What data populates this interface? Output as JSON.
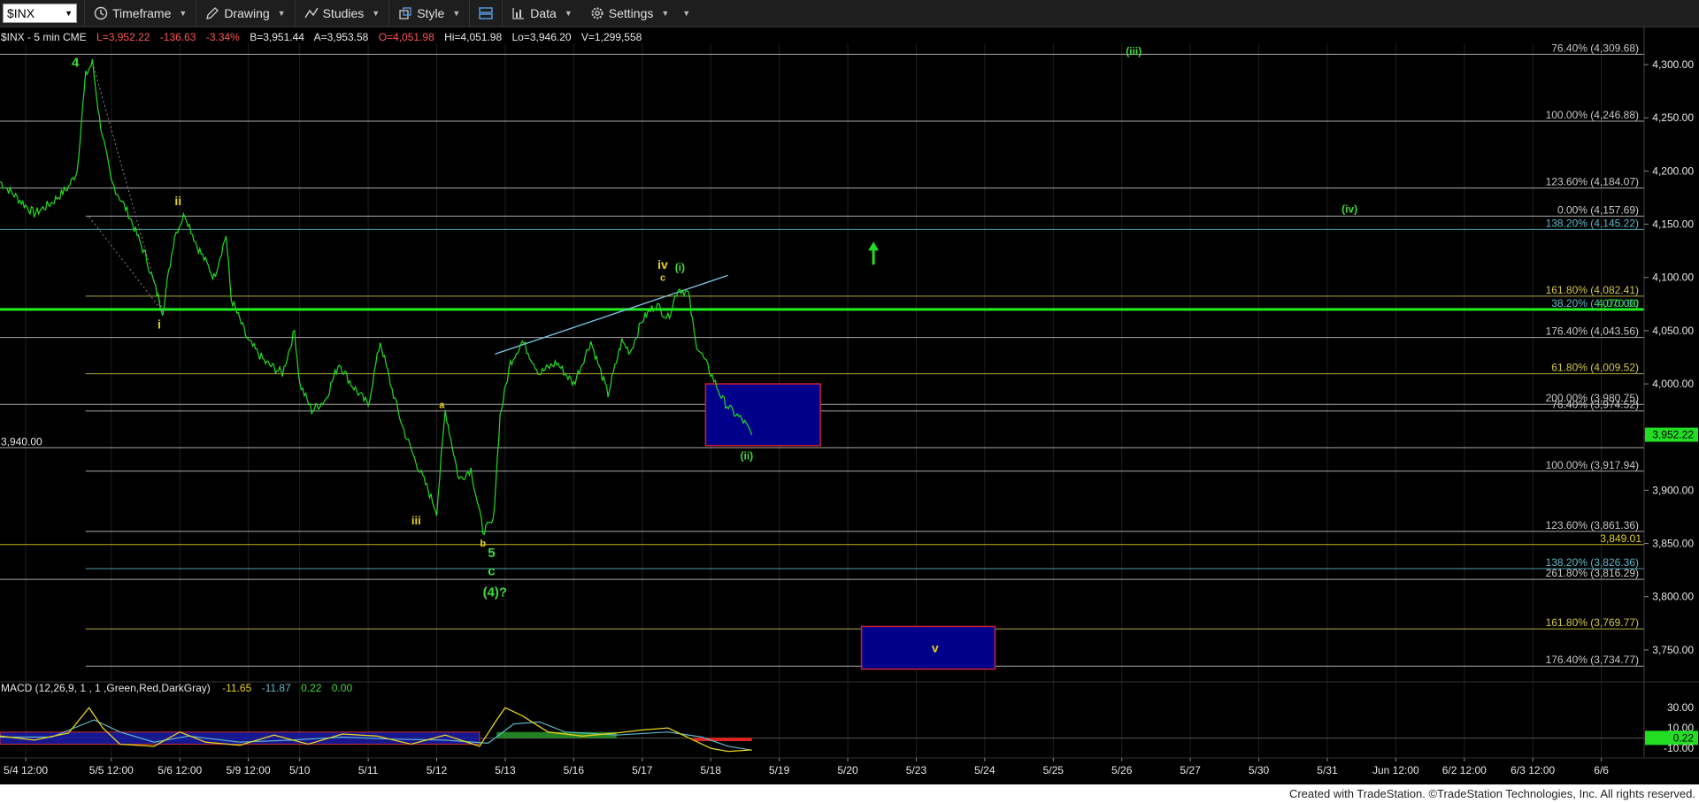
{
  "toolbar": {
    "symbol": "$INX",
    "timeframe": "Timeframe",
    "drawing": "Drawing",
    "studies": "Studies",
    "style": "Style",
    "data": "Data",
    "settings": "Settings"
  },
  "header": {
    "symbol_info": "$INX - 5 min  CME",
    "last": "L=3,952.22",
    "change": "-136.63",
    "change_pct": "-3.34%",
    "bid": "B=3,951.44",
    "ask": "A=3,953.58",
    "open": "O=4,051.98",
    "high": "Hi=4,051.98",
    "low": "Lo=3,946.20",
    "volume": "V=1,299,558"
  },
  "footer": "Created with TradeStation. ©TradeStation Technologies, Inc. All rights reserved.",
  "colors": {
    "price": "#22dd22",
    "fib": "#c8c8c8",
    "wave_yellow": "#e6d21e",
    "wave_green": "#3ddc3d",
    "box_fill": "#00008b",
    "box_border": "#cc2233",
    "trend": "#7ecbe8"
  },
  "chart_data": {
    "type": "line",
    "ylim": [
      3720,
      4320
    ],
    "price_ticks": [
      "4,300.00",
      "4,250.00",
      "4,200.00",
      "4,150.00",
      "4,100.00",
      "4,050.00",
      "4,000.00",
      "3,950.00",
      "3,900.00",
      "3,850.00",
      "3,800.00",
      "3,750.00"
    ],
    "tick_values": [
      4300,
      4250,
      4200,
      4150,
      4100,
      4050,
      4000,
      3950,
      3900,
      3850,
      3800,
      3750
    ],
    "x_labels": [
      "5/4 12:00",
      "5/5 12:00",
      "5/6 12:00",
      "5/9 12:00",
      "5/10",
      "5/11",
      "5/12",
      "5/13",
      "5/16",
      "5/17",
      "5/18",
      "5/19",
      "5/20",
      "5/23",
      "5/24",
      "5/25",
      "5/26",
      "5/27",
      "5/30",
      "5/31",
      "Jun 12:00",
      "6/2 12:00",
      "6/3 12:00",
      "6/6"
    ],
    "x_positions": [
      1.5,
      6.5,
      10.5,
      14.5,
      17.5,
      21.5,
      25.5,
      29.5,
      33.5,
      37.5,
      41.5,
      45.5,
      49.5,
      53.5,
      57.5,
      61.5,
      65.5,
      69.5,
      73.5,
      77.5,
      81.5,
      85.5,
      89.5,
      93.5
    ],
    "x_range": [
      0,
      96
    ],
    "price_series": [
      [
        0,
        4190
      ],
      [
        1,
        4175
      ],
      [
        2,
        4160
      ],
      [
        3,
        4170
      ],
      [
        4,
        4185
      ],
      [
        4.5,
        4200
      ],
      [
        5,
        4290
      ],
      [
        5.4,
        4302
      ],
      [
        5.8,
        4250
      ],
      [
        6.5,
        4190
      ],
      [
        7.5,
        4160
      ],
      [
        8.5,
        4120
      ],
      [
        9.5,
        4068
      ],
      [
        10.2,
        4140
      ],
      [
        10.8,
        4160
      ],
      [
        11.5,
        4130
      ],
      [
        12.5,
        4100
      ],
      [
        13.2,
        4140
      ],
      [
        13.5,
        4080
      ],
      [
        14.5,
        4040
      ],
      [
        15.5,
        4020
      ],
      [
        16.5,
        4010
      ],
      [
        17.2,
        4050
      ],
      [
        17.5,
        4000
      ],
      [
        18.2,
        3975
      ],
      [
        19,
        3985
      ],
      [
        19.8,
        4020
      ],
      [
        20.5,
        4000
      ],
      [
        21.5,
        3980
      ],
      [
        22.2,
        4040
      ],
      [
        22.8,
        4000
      ],
      [
        23.5,
        3960
      ],
      [
        24.2,
        3930
      ],
      [
        25,
        3900
      ],
      [
        25.5,
        3880
      ],
      [
        26,
        3975
      ],
      [
        26.8,
        3910
      ],
      [
        27.5,
        3920
      ],
      [
        28.2,
        3862
      ],
      [
        28.8,
        3870
      ],
      [
        29.2,
        3970
      ],
      [
        29.8,
        4020
      ],
      [
        30.5,
        4040
      ],
      [
        31.5,
        4010
      ],
      [
        32.5,
        4020
      ],
      [
        33.5,
        4000
      ],
      [
        34.5,
        4040
      ],
      [
        35.5,
        3990
      ],
      [
        36.3,
        4040
      ],
      [
        36.8,
        4030
      ],
      [
        37.5,
        4060
      ],
      [
        38.3,
        4075
      ],
      [
        39,
        4062
      ],
      [
        39.6,
        4090
      ],
      [
        40.2,
        4085
      ],
      [
        40.6,
        4040
      ],
      [
        41.5,
        4010
      ],
      [
        42.2,
        3985
      ],
      [
        42.7,
        3975
      ],
      [
        43.4,
        3965
      ],
      [
        43.9,
        3952
      ]
    ],
    "fib_levels": [
      {
        "value": 4309.68,
        "label": "76.40% (4,309.68)",
        "color": "#c8c8c8",
        "x0": 0
      },
      {
        "value": 4246.88,
        "label": "100.00% (4,246.88)",
        "color": "#c8c8c8",
        "x0": 0
      },
      {
        "value": 4184.07,
        "label": "123.60% (4,184.07)",
        "color": "#c8c8c8",
        "x0": 0
      },
      {
        "value": 4157.69,
        "label": "0.00% (4,157.69)",
        "color": "#c8c8c8",
        "x0": 5
      },
      {
        "value": 4145.22,
        "label": "138.20% (4,145.22)",
        "color": "#5fb8c8",
        "x0": 0
      },
      {
        "value": 4082.41,
        "label": "161.80% (4,082.41)",
        "color": "#d2c74a",
        "x0": 5
      },
      {
        "value": 4070.0,
        "label": "38.20% (4,070.00)",
        "color": "#5fb8c8",
        "x0": 0
      },
      {
        "value": 4043.56,
        "label": "176.40% (4,043.56)",
        "color": "#c8c8c8",
        "x0": 0
      },
      {
        "value": 4009.52,
        "label": "61.80% (4,009.52)",
        "color": "#d2c74a",
        "x0": 5
      },
      {
        "value": 3980.75,
        "label": "200.00% (3,980.75)",
        "color": "#c8c8c8",
        "x0": 0
      },
      {
        "value": 3974.52,
        "label": "76.40% (3,974.52)",
        "color": "#c8c8c8",
        "x0": 5
      },
      {
        "value": 3940.0,
        "label": "",
        "color": "#c8c8c8",
        "x0": 0
      },
      {
        "value": 3917.94,
        "label": "100.00% (3,917.94)",
        "color": "#c8c8c8",
        "x0": 5
      },
      {
        "value": 3861.36,
        "label": "123.60% (3,861.36)",
        "color": "#c8c8c8",
        "x0": 5
      },
      {
        "value": 3849.01,
        "label": "",
        "color": "#e6d21e",
        "x0": 0
      },
      {
        "value": 3826.36,
        "label": "138.20% (3,826.36)",
        "color": "#5fb8c8",
        "x0": 5
      },
      {
        "value": 3816.29,
        "label": "261.80% (3,816.29)",
        "color": "#c8c8c8",
        "x0": 0
      },
      {
        "value": 3769.77,
        "label": "161.80% (3,769.77)",
        "color": "#d2c74a",
        "x0": 5
      },
      {
        "value": 3734.77,
        "label": "176.40% (3,734.77)",
        "color": "#c8c8c8",
        "x0": 5
      }
    ],
    "green_line": {
      "value": 4070.0,
      "label": "4,070.00"
    },
    "left_label": {
      "value": 3940.0,
      "label": "3,940.00"
    },
    "last_price": {
      "value": 3952.22,
      "label": "3,952.22"
    },
    "yellow_line": {
      "value": 3849.01,
      "label": "3,849.01"
    },
    "boxes": [
      {
        "x0": 41.2,
        "x1": 47.9,
        "y0": 4000,
        "y1": 3942
      },
      {
        "x0": 50.3,
        "x1": 58.1,
        "y0": 3772,
        "y1": 3732
      }
    ],
    "trendline": {
      "x0": 28.9,
      "y0": 4028,
      "x1": 42.5,
      "y1": 4102
    },
    "wave_labels": [
      {
        "text": "4",
        "x": 4.4,
        "y": 4298,
        "color": "#3ddc3d",
        "size": 15
      },
      {
        "text": "ii",
        "x": 10.4,
        "y": 4168,
        "color": "#e6d21e",
        "size": 14
      },
      {
        "text": "i",
        "x": 9.3,
        "y": 4052,
        "color": "#e6d21e",
        "size": 14
      },
      {
        "text": "iii",
        "x": 24.3,
        "y": 3868,
        "color": "#e6d21e",
        "size": 13
      },
      {
        "text": "a",
        "x": 25.8,
        "y": 3977,
        "color": "#e6d21e",
        "size": 11
      },
      {
        "text": "b",
        "x": 28.2,
        "y": 3847,
        "color": "#e6d21e",
        "size": 11
      },
      {
        "text": "5",
        "x": 28.7,
        "y": 3837,
        "color": "#3ddc3d",
        "size": 15
      },
      {
        "text": "c",
        "x": 28.7,
        "y": 3820,
        "color": "#3ddc3d",
        "size": 15
      },
      {
        "text": "(4)?",
        "x": 28.9,
        "y": 3800,
        "color": "#3ddc3d",
        "size": 15
      },
      {
        "text": "iv",
        "x": 38.7,
        "y": 4108,
        "color": "#e6d21e",
        "size": 14
      },
      {
        "text": "c",
        "x": 38.7,
        "y": 4097,
        "color": "#e6d21e",
        "size": 11
      },
      {
        "text": "(i)",
        "x": 39.7,
        "y": 4106,
        "color": "#3ddc3d",
        "size": 12
      },
      {
        "text": "(ii)",
        "x": 43.6,
        "y": 3929,
        "color": "#3ddc3d",
        "size": 12
      },
      {
        "text": "(iii)",
        "x": 66.2,
        "y": 4309,
        "color": "#3ddc3d",
        "size": 12
      },
      {
        "text": "(iv)",
        "x": 78.8,
        "y": 4161,
        "color": "#3ddc3d",
        "size": 12
      },
      {
        "text": "v",
        "x": 54.6,
        "y": 3748,
        "color": "#e6d21e",
        "size": 14
      }
    ],
    "arrow": {
      "x": 51.0,
      "y0": 4112,
      "y1": 4132,
      "color": "#22dd22"
    }
  },
  "macd": {
    "title": "MACD (12,26,9, 1 , 1 ,Green,Red,DarkGray)",
    "v1": "-11.65",
    "v2": "-11.87",
    "v3": "0.22",
    "v4": "0.00",
    "ticks": [
      "30.00",
      "10.00",
      "0.22",
      "-10.00"
    ],
    "tick_values": [
      30,
      10,
      0.22,
      -10
    ],
    "ylim": [
      -16,
      38
    ],
    "macd_series": [
      [
        0,
        2
      ],
      [
        2,
        -2
      ],
      [
        4,
        5
      ],
      [
        5.2,
        30
      ],
      [
        6,
        10
      ],
      [
        7,
        -6
      ],
      [
        9,
        -8
      ],
      [
        10.5,
        6
      ],
      [
        12,
        -4
      ],
      [
        14,
        -7
      ],
      [
        16,
        3
      ],
      [
        18,
        -6
      ],
      [
        20,
        4
      ],
      [
        22,
        2
      ],
      [
        24,
        -6
      ],
      [
        26,
        3
      ],
      [
        28,
        -8
      ],
      [
        29,
        18
      ],
      [
        29.5,
        30
      ],
      [
        30.5,
        22
      ],
      [
        32,
        6
      ],
      [
        34,
        2
      ],
      [
        36,
        5
      ],
      [
        37.5,
        8
      ],
      [
        39,
        10
      ],
      [
        40.5,
        -2
      ],
      [
        41.5,
        -10
      ],
      [
        42.5,
        -13
      ],
      [
        43.9,
        -11.65
      ]
    ],
    "signal_series": [
      [
        0,
        1
      ],
      [
        3,
        1
      ],
      [
        5.5,
        18
      ],
      [
        7,
        6
      ],
      [
        9,
        -4
      ],
      [
        11,
        2
      ],
      [
        14,
        -4
      ],
      [
        17,
        -2
      ],
      [
        20,
        1
      ],
      [
        23,
        -1
      ],
      [
        26,
        -2
      ],
      [
        28.5,
        -5
      ],
      [
        30,
        14
      ],
      [
        31.5,
        16
      ],
      [
        33,
        6
      ],
      [
        36,
        3
      ],
      [
        39,
        6
      ],
      [
        41,
        1
      ],
      [
        42.5,
        -8
      ],
      [
        43.9,
        -11.87
      ]
    ]
  }
}
